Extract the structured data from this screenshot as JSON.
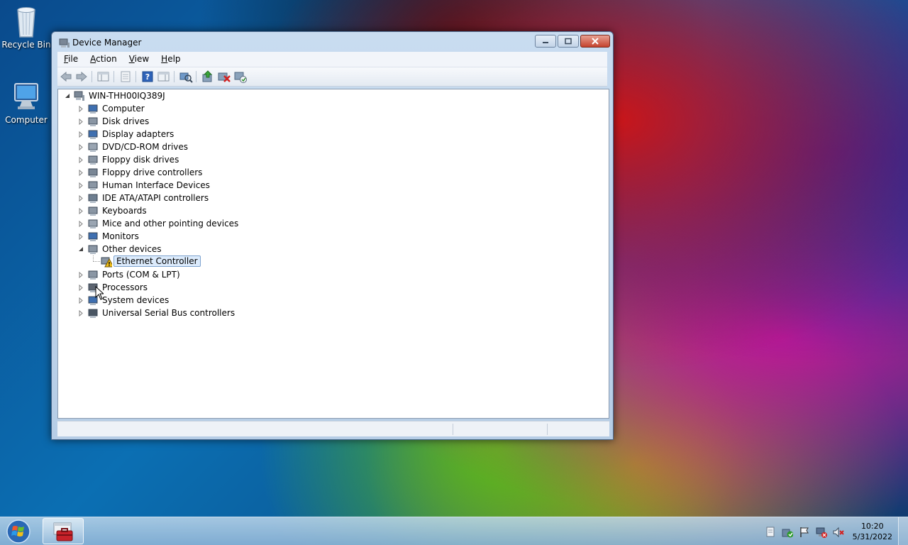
{
  "desktop": {
    "icons": [
      {
        "label": "Recycle Bin",
        "icon": "recycle-bin-icon"
      },
      {
        "label": "Computer",
        "icon": "computer-icon"
      }
    ]
  },
  "window": {
    "title": "Device Manager",
    "menu": [
      {
        "pre": "",
        "accel": "F",
        "post": "ile"
      },
      {
        "pre": "",
        "accel": "A",
        "post": "ction"
      },
      {
        "pre": "",
        "accel": "V",
        "post": "iew"
      },
      {
        "pre": "",
        "accel": "H",
        "post": "elp"
      }
    ],
    "toolbar": [
      "back-icon",
      "forward-icon",
      "show-hide-console-tree-icon",
      "properties-icon",
      "help-icon",
      "action-pane-icon",
      "scan-hardware-icon",
      "update-driver-icon",
      "uninstall-icon",
      "enable-device-icon"
    ]
  },
  "tree": {
    "root": "WIN-THH00IQ389J",
    "categories": [
      "Computer",
      "Disk drives",
      "Display adapters",
      "DVD/CD-ROM drives",
      "Floppy disk drives",
      "Floppy drive controllers",
      "Human Interface Devices",
      "IDE ATA/ATAPI controllers",
      "Keyboards",
      "Mice and other pointing devices",
      "Monitors",
      "Other devices",
      "Ports (COM & LPT)",
      "Processors",
      "System devices",
      "Universal Serial Bus controllers"
    ],
    "expanded": "Other devices",
    "child": "Ethernet Controller"
  },
  "taskbar": {
    "time": "10:20",
    "date": "5/31/2022",
    "tray": [
      "action-center-icon",
      "security-icon",
      "flag-icon",
      "network-icon",
      "volume-muted-icon"
    ]
  },
  "colors": {
    "selection_bg": "#dcebfc",
    "selection_border": "#7da2ce",
    "warning": "#f2c01a"
  }
}
